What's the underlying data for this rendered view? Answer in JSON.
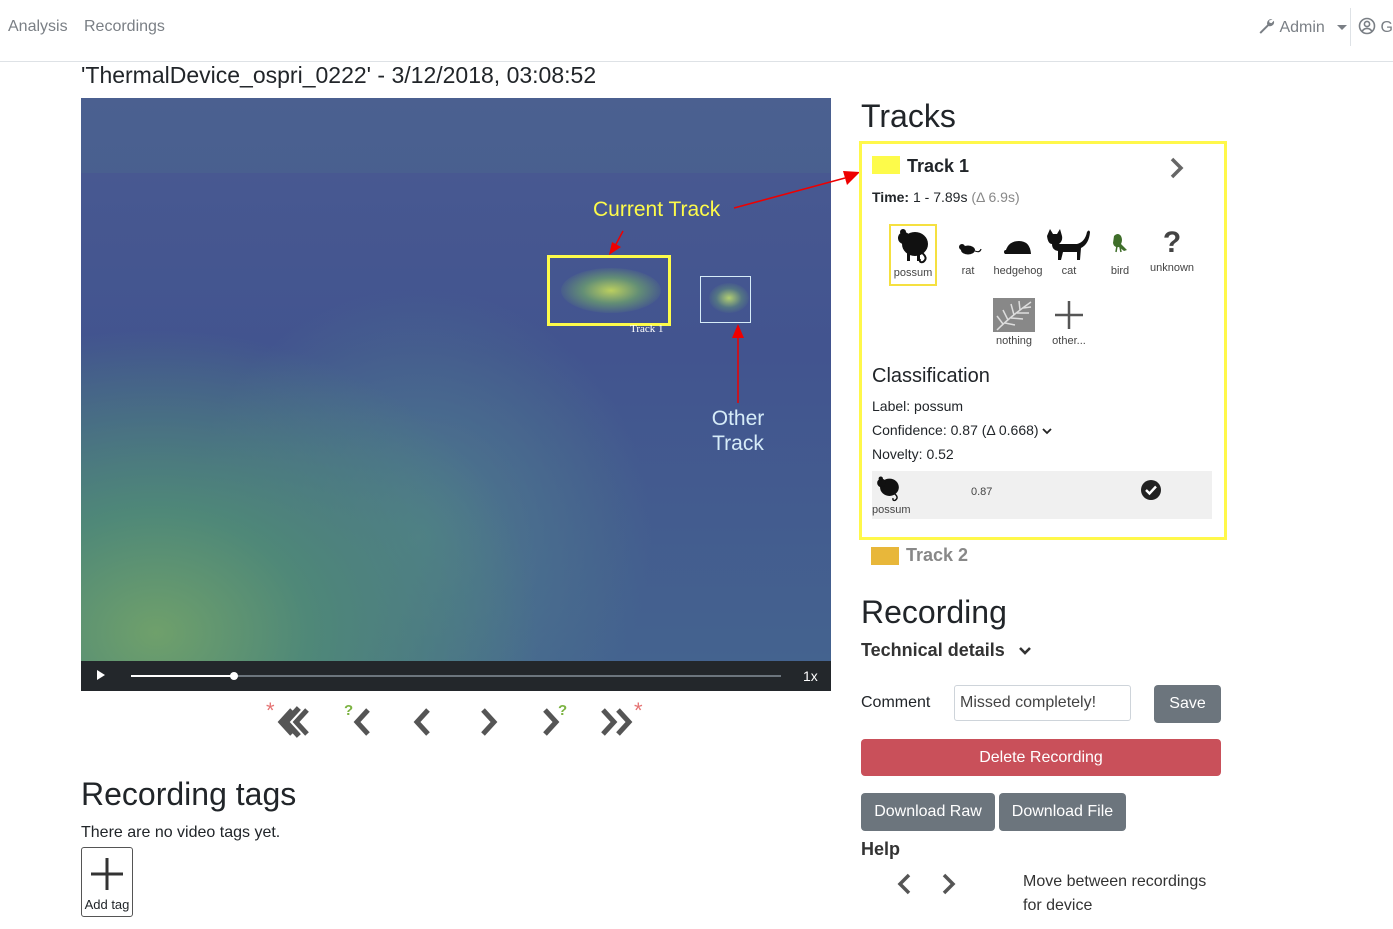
{
  "nav": {
    "analysis": "Analysis",
    "recordings": "Recordings",
    "admin": "Admin",
    "user_initial": "G"
  },
  "recording": {
    "title": "'ThermalDevice_ospri_0222' - 3/12/2018, 03:08:52"
  },
  "video": {
    "annotation_current": "Current Track",
    "annotation_other_line1": "Other",
    "annotation_other_line2": "Track",
    "box_label": "Track 1",
    "speed": "1x",
    "progress": 0.16
  },
  "track_nav": {
    "star": "*",
    "question": "?"
  },
  "tracks": {
    "heading": "Tracks",
    "track1": {
      "name": "Track 1",
      "time_label": "Time:",
      "time_value": "1 - 7.89s",
      "delta": "(Δ 6.9s)",
      "color": "#fdfb4a",
      "animals": [
        "possum",
        "rat",
        "hedgehog",
        "cat",
        "bird",
        "unknown",
        "nothing",
        "other..."
      ],
      "classification": {
        "heading": "Classification",
        "label": "Label: possum",
        "confidence": "Confidence: 0.87 (Δ 0.668)",
        "novelty": "Novelty: 0.52",
        "row_animal": "possum",
        "row_value": "0.87"
      }
    },
    "track2": {
      "name": "Track 2",
      "color": "#e8b73a"
    }
  },
  "recording_panel": {
    "heading": "Recording",
    "technical": "Technical details",
    "comment_label": "Comment",
    "comment_value": "Missed completely!",
    "save": "Save",
    "delete": "Delete Recording",
    "download_raw": "Download Raw",
    "download_file": "Download File",
    "help_heading": "Help",
    "help_text1": "Move between recordings",
    "help_text2": "for device"
  },
  "tags": {
    "heading": "Recording tags",
    "empty": "There are no video tags yet.",
    "add": "Add tag"
  }
}
